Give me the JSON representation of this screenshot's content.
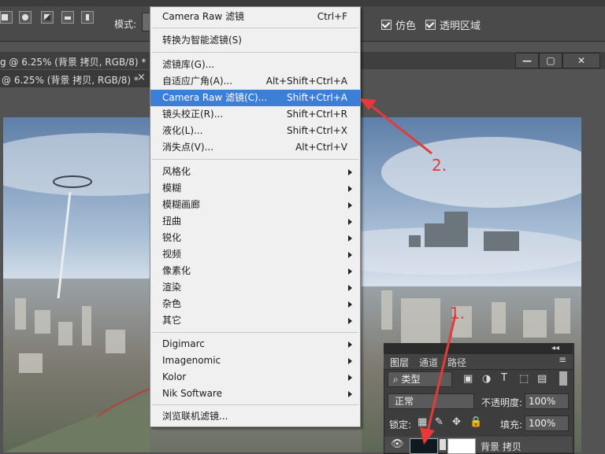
{
  "options_bar": {
    "mode_label": "模式:",
    "antialias_label": "仿色",
    "transparency_label": "透明区域"
  },
  "doc_tabs": [
    {
      "label": "g @ 6.25% (背景 拷贝, RGB/8) *"
    },
    {
      "label": "@ 6.25% (背景 拷贝, RGB/8) *",
      "close": "×"
    }
  ],
  "window_buttons": [
    "—",
    "▢",
    "✕"
  ],
  "filter_menu": {
    "groups": [
      [
        {
          "label": "Camera Raw 滤镜",
          "shortcut": "Ctrl+F"
        }
      ],
      [
        {
          "label": "转换为智能滤镜(S)",
          "shortcut": ""
        }
      ],
      [
        {
          "label": "滤镜库(G)...",
          "shortcut": ""
        },
        {
          "label": "自适应广角(A)...",
          "shortcut": "Alt+Shift+Ctrl+A"
        },
        {
          "label": "Camera Raw 滤镜(C)...",
          "shortcut": "Shift+Ctrl+A",
          "highlighted": true
        },
        {
          "label": "镜头校正(R)...",
          "shortcut": "Shift+Ctrl+R"
        },
        {
          "label": "液化(L)...",
          "shortcut": "Shift+Ctrl+X"
        },
        {
          "label": "消失点(V)...",
          "shortcut": "Alt+Ctrl+V"
        }
      ],
      [
        {
          "label": "风格化",
          "submenu": true
        },
        {
          "label": "模糊",
          "submenu": true
        },
        {
          "label": "模糊画廊",
          "submenu": true
        },
        {
          "label": "扭曲",
          "submenu": true
        },
        {
          "label": "锐化",
          "submenu": true
        },
        {
          "label": "视频",
          "submenu": true
        },
        {
          "label": "像素化",
          "submenu": true
        },
        {
          "label": "渲染",
          "submenu": true
        },
        {
          "label": "杂色",
          "submenu": true
        },
        {
          "label": "其它",
          "submenu": true
        }
      ],
      [
        {
          "label": "Digimarc",
          "submenu": true
        },
        {
          "label": "Imagenomic",
          "submenu": true
        },
        {
          "label": "Kolor",
          "submenu": true
        },
        {
          "label": "Nik Software",
          "submenu": true
        }
      ],
      [
        {
          "label": "浏览联机滤镜...",
          "shortcut": ""
        }
      ]
    ]
  },
  "layers_panel": {
    "tabs": [
      "图层",
      "通道",
      "路径"
    ],
    "collapse": "◂◂",
    "filter_kind": "类型",
    "blend_mode": "正常",
    "opacity_label": "不透明度:",
    "opacity_value": "100%",
    "lock_label": "锁定:",
    "fill_label": "填充:",
    "fill_value": "100%",
    "layer_name": "背景 拷贝"
  },
  "annotations": {
    "step1": "1.",
    "step2": "2."
  },
  "colors": {
    "highlight": "#3b7fd8",
    "annotation": "#e53a3a"
  }
}
